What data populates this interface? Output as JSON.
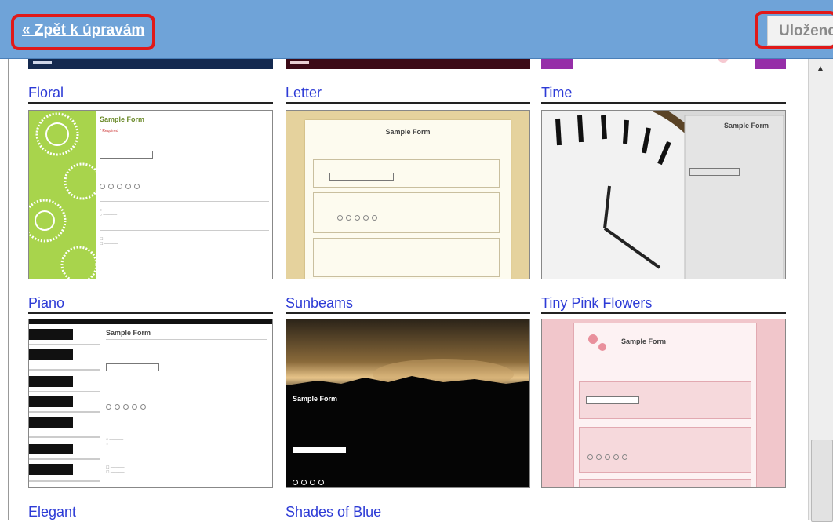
{
  "header": {
    "back_link": "« Zpět k úpravám",
    "saved_label": "Uloženo"
  },
  "themes": [
    {
      "name": "Floral"
    },
    {
      "name": "Letter"
    },
    {
      "name": "Time"
    },
    {
      "name": "Piano"
    },
    {
      "name": "Sunbeams"
    },
    {
      "name": "Tiny Pink Flowers"
    },
    {
      "name": "Elegant"
    },
    {
      "name": "Shades of Blue"
    }
  ],
  "sample": {
    "form_title": "Sample Form"
  },
  "colors": {
    "topbar": "#6fa3d8",
    "highlight": "#e01919",
    "link": "#2d3bd6"
  }
}
